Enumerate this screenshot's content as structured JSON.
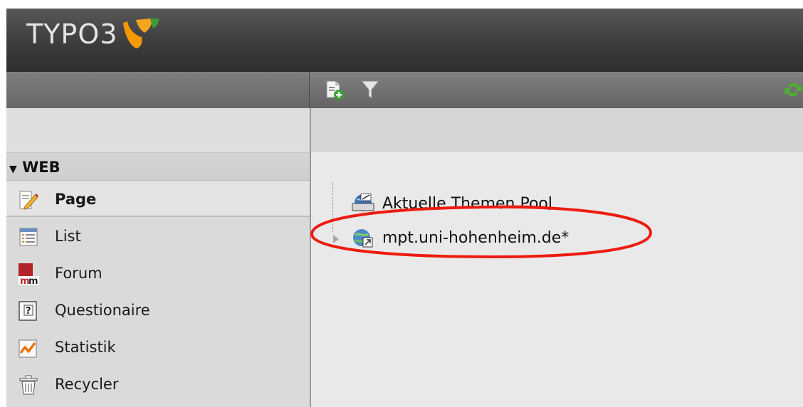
{
  "header": {
    "logo_text": "TYPO3",
    "brand_color": "#f49800"
  },
  "toolbar": {
    "new_page_icon": "page-add-icon",
    "filter_icon": "filter-icon",
    "refresh_icon": "refresh-icon"
  },
  "modules": {
    "group_label": "WEB",
    "items": [
      {
        "label": "Page",
        "icon": "page-edit-icon",
        "active": true
      },
      {
        "label": "List",
        "icon": "list-icon",
        "active": false
      },
      {
        "label": "Forum",
        "icon": "forum-mm-icon",
        "active": false
      },
      {
        "label": "Questionaire",
        "icon": "question-icon",
        "active": false
      },
      {
        "label": "Statistik",
        "icon": "statistics-icon",
        "active": false
      },
      {
        "label": "Recycler",
        "icon": "trash-icon",
        "active": false
      }
    ]
  },
  "page_tree": {
    "nodes": [
      {
        "label": "Aktuelle Themen Pool",
        "icon": "globe-storage-icon"
      },
      {
        "label": "mpt.uni-hohenheim.de*",
        "icon": "globe-shortcut-icon"
      }
    ]
  },
  "annotation_color": "#ee1b10"
}
